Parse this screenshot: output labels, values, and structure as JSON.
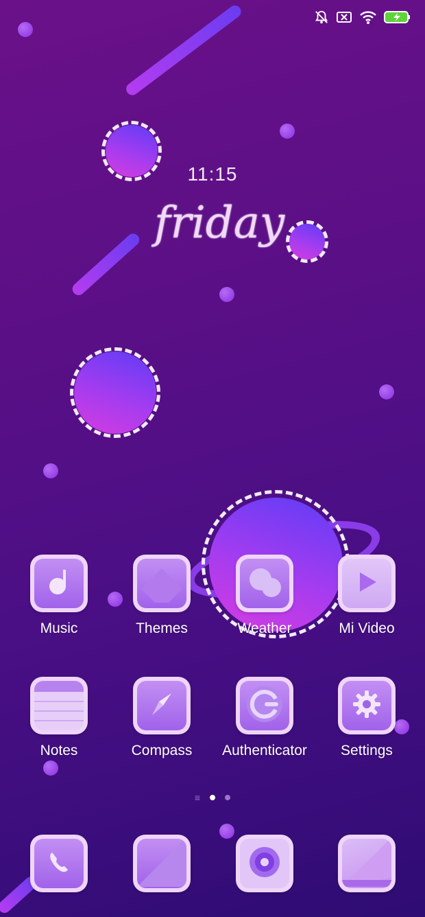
{
  "status_bar": {
    "icons": [
      "mute-notifications-icon",
      "no-sim-icon",
      "wifi-icon",
      "battery-charging-icon"
    ]
  },
  "clock": {
    "time": "11:15",
    "day": "friday"
  },
  "home": {
    "row1": [
      {
        "label": "Music",
        "icon": "music-note-icon"
      },
      {
        "label": "Themes",
        "icon": "themes-diamond-icon"
      },
      {
        "label": "Weather",
        "icon": "weather-cloud-icon"
      },
      {
        "label": "Mi Video",
        "icon": "play-icon"
      }
    ],
    "row2": [
      {
        "label": "Notes",
        "icon": "notes-icon"
      },
      {
        "label": "Compass",
        "icon": "compass-icon"
      },
      {
        "label": "Authenticator",
        "icon": "authenticator-icon"
      },
      {
        "label": "Settings",
        "icon": "gear-icon"
      }
    ]
  },
  "page_indicator": {
    "pages": 3,
    "active": 1
  },
  "dock": {
    "icons": [
      "phone-icon",
      "messages-icon",
      "camera-icon",
      "browser-icon"
    ]
  },
  "colors": {
    "tile": "#efd5f8",
    "accent": "#a162ea",
    "background": "#5a0f86"
  }
}
